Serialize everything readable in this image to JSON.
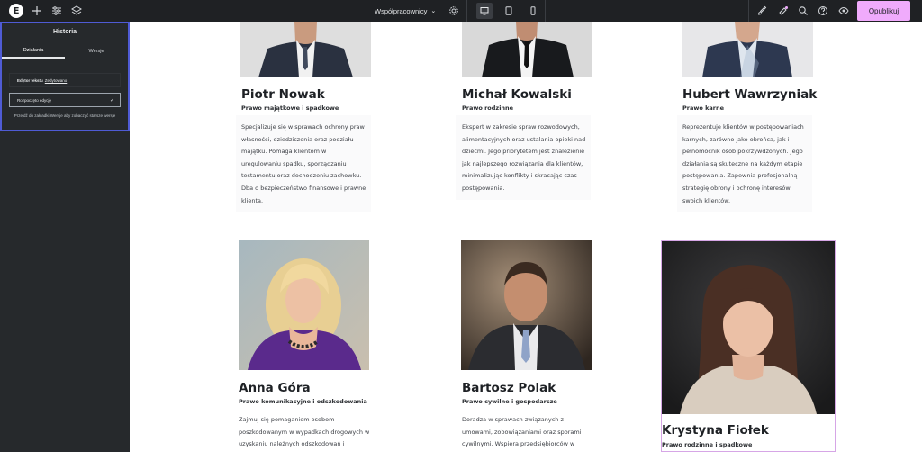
{
  "topbar": {
    "logo_letter": "E",
    "page_name": "Współpracownicy",
    "publish_label": "Opublikuj",
    "icons": [
      "plus-icon",
      "sliders-icon",
      "layers-icon",
      "gear-icon",
      "desktop-icon",
      "tablet-icon",
      "mobile-icon",
      "brush-icon",
      "notifications-icon",
      "search-icon",
      "help-icon",
      "eye-icon"
    ]
  },
  "history_panel": {
    "title": "Historia",
    "tabs": [
      "Działania",
      "Wersje"
    ],
    "entries": [
      {
        "bold": "Edytor tekstu",
        "detail": "Zedytowano"
      },
      {
        "bold": "",
        "detail": "Rozpoczęto edycję"
      }
    ],
    "hint": "Przejdź do zakładki Wersje aby zobaczyć starsze wersje"
  },
  "team": [
    {
      "name": "Piotr Nowak",
      "specialty": "Prawo majątkowe i spadkowe",
      "bio_lines": [
        "Specjalizuje się w sprawach ochrony praw",
        "własności, dziedziczenia oraz podziału",
        "majątku.  Pomaga klientom w",
        "uregulowaniu spadku, sporządzaniu",
        "testamentu oraz dochodzeniu zachowku.",
        "Dba o bezpieczeństwo finansowe i prawne",
        "klienta."
      ]
    },
    {
      "name": "Michał Kowalski",
      "specialty": "Prawo rodzinne",
      "bio_lines": [
        "Ekspert w zakresie spraw rozwodowych,",
        "alimentacyjnych oraz ustalania opieki nad",
        "dziećmi. Jego priorytetem jest znalezienie",
        "jak najlepszego rozwiązania dla klientów,",
        "minimalizując konflikty i skracając czas",
        "postępowania."
      ]
    },
    {
      "name": "Hubert Wawrzyniak",
      "specialty": "Prawo karne",
      "bio_lines": [
        "Reprezentuje klientów w postępowaniach",
        "karnych, zarówno jako obrońca, jak i",
        "pełnomocnik osób pokrzywdzonych. Jego",
        "działania są skuteczne na każdym etapie",
        "postępowania. Zapewnia profesjonalną",
        "strategię obrony i ochronę interesów",
        "swoich klientów."
      ]
    },
    {
      "name": "Anna Góra",
      "specialty": "Prawo komunikacyjne i odszkodowania",
      "bio_lines": [
        "Zajmuj się pomaganiem osobom",
        "poszkodowanym w wypadkach drogowych w",
        "uzyskaniu należnych odszkodowań i"
      ]
    },
    {
      "name": "Bartosz Polak",
      "specialty": "Prawo cywilne i gospodarcze",
      "bio_lines": [
        "Doradza w sprawach związanych z",
        "umowami, zobowiązaniami oraz sporami",
        "cywilnymi. Wspiera przedsiębiorców w"
      ]
    },
    {
      "name": "Krystyna Fiołek",
      "specialty": "Prawo rodzinne i spadkowe",
      "bio_lines": []
    }
  ]
}
